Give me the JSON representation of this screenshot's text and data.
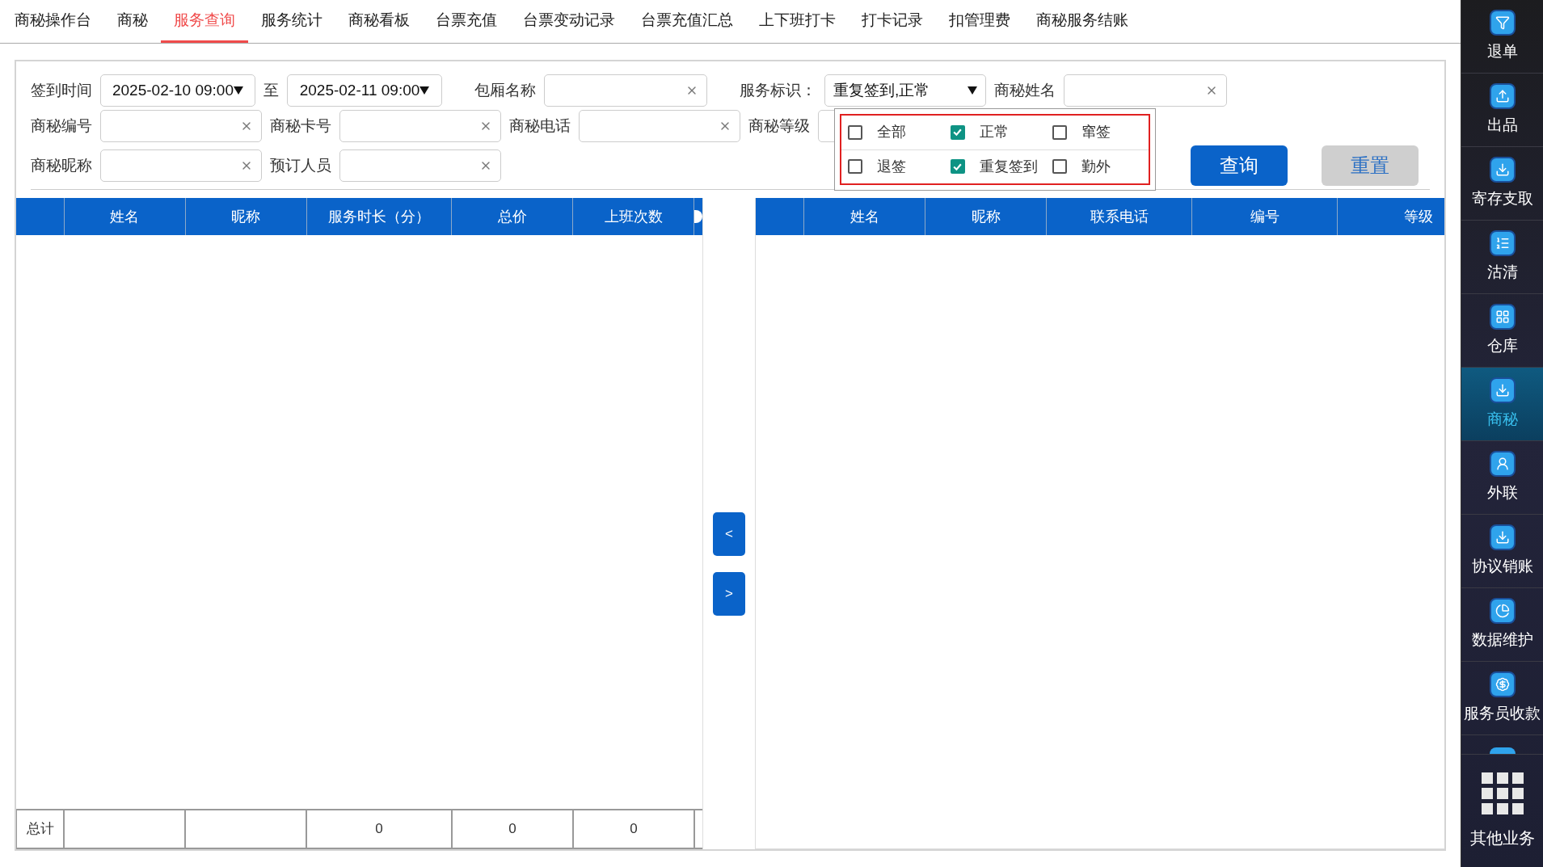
{
  "tabs": [
    {
      "label": "商秘操作台",
      "selected": false
    },
    {
      "label": "商秘",
      "selected": false
    },
    {
      "label": "服务查询",
      "selected": true
    },
    {
      "label": "服务统计",
      "selected": false
    },
    {
      "label": "商秘看板",
      "selected": false
    },
    {
      "label": "台票充值",
      "selected": false
    },
    {
      "label": "台票变动记录",
      "selected": false
    },
    {
      "label": "台票充值汇总",
      "selected": false
    },
    {
      "label": "上下班打卡",
      "selected": false
    },
    {
      "label": "打卡记录",
      "selected": false
    },
    {
      "label": "扣管理费",
      "selected": false
    },
    {
      "label": "商秘服务结账",
      "selected": false
    }
  ],
  "filters": {
    "checkin_label": "签到时间",
    "checkin_from": "2025-02-10 09:00",
    "to_label": "至",
    "checkin_to": "2025-02-11 09:00",
    "room_label": "包厢名称",
    "flag_label": "服务标识：",
    "flag_value": "重复签到,正常",
    "name_label": "商秘姓名",
    "number_label": "商秘编号",
    "card_label": "商秘卡号",
    "phone_label": "商秘电话",
    "level_label": "商秘等级",
    "nickname_label": "商秘昵称",
    "booker_label": "预订人员"
  },
  "flag_options": [
    {
      "label": "全部",
      "checked": false
    },
    {
      "label": "正常",
      "checked": true
    },
    {
      "label": "窜签",
      "checked": false
    },
    {
      "label": "退签",
      "checked": false
    },
    {
      "label": "重复签到",
      "checked": true
    },
    {
      "label": "勤外",
      "checked": false
    }
  ],
  "buttons": {
    "query": "查询",
    "reset": "重置"
  },
  "left_table": {
    "columns": [
      "姓名",
      "昵称",
      "服务时长（分）",
      "总价",
      "上班次数"
    ],
    "footer": {
      "label": "总计",
      "cells": [
        "",
        "",
        "0",
        "0",
        "0"
      ]
    }
  },
  "move_buttons": [
    "<",
    ">"
  ],
  "right_table": {
    "columns": [
      "姓名",
      "昵称",
      "联系电话",
      "编号",
      "等级"
    ]
  },
  "sidebar": [
    {
      "label": "退单",
      "selected": false
    },
    {
      "label": "出品",
      "selected": false
    },
    {
      "label": "寄存支取",
      "selected": false
    },
    {
      "label": "沽清",
      "selected": false
    },
    {
      "label": "仓库",
      "selected": false
    },
    {
      "label": "商秘",
      "selected": true
    },
    {
      "label": "外联",
      "selected": false
    },
    {
      "label": "协议销账",
      "selected": false
    },
    {
      "label": "数据维护",
      "selected": false
    },
    {
      "label": "服务员收款",
      "selected": false
    }
  ],
  "other_business": "其他业务"
}
